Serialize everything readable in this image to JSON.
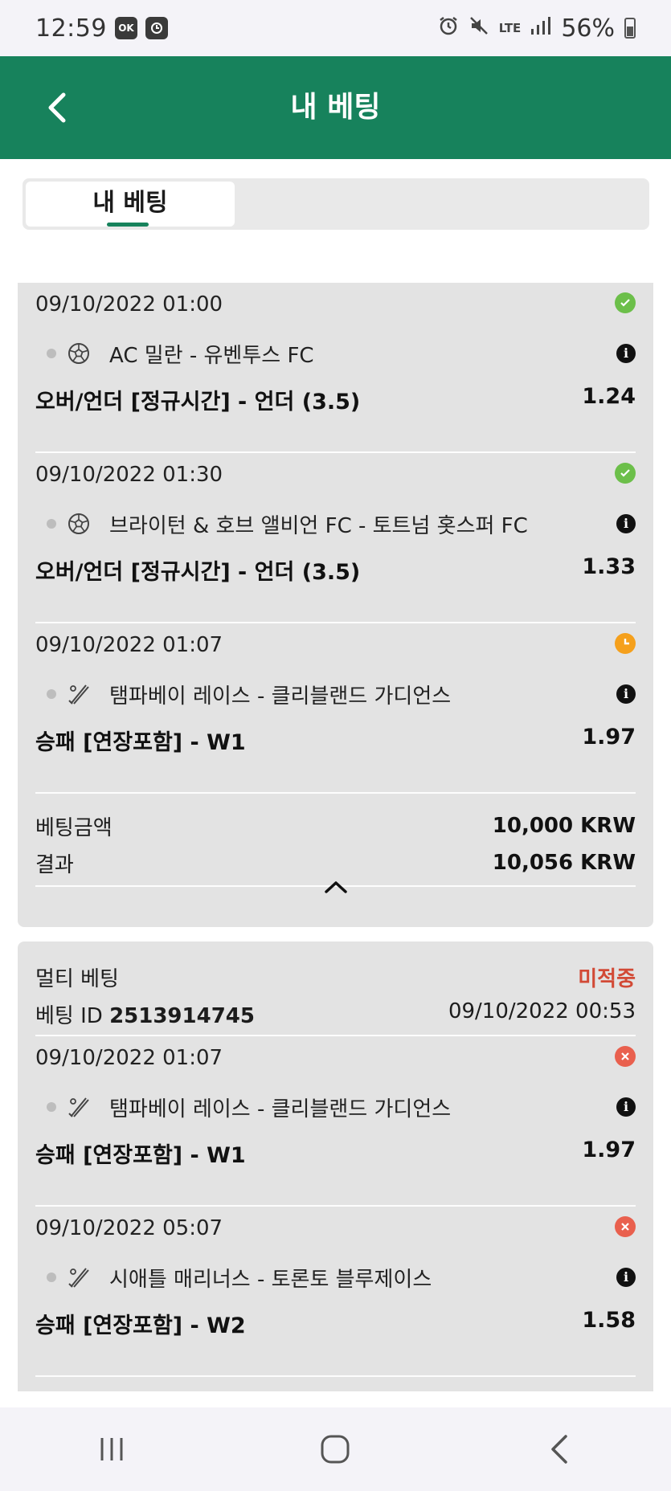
{
  "status_bar": {
    "time": "12:59",
    "app_icons": [
      "ok-app-icon",
      "clock-app-icon"
    ],
    "app_icon_text": "OK",
    "network": "LTE",
    "battery": "56%"
  },
  "header": {
    "title": "내 베팅"
  },
  "tabs": [
    {
      "label": "내 베팅",
      "active": true
    }
  ],
  "bet_slip_1": {
    "items": [
      {
        "datetime": "09/10/2022 01:00",
        "status": "won",
        "sport": "soccer",
        "match": "AC 밀란 - 유벤투스 FC",
        "market": "오버/언더 [정규시간] - 언더 (3.5)",
        "odds": "1.24"
      },
      {
        "datetime": "09/10/2022 01:30",
        "status": "won",
        "sport": "soccer",
        "match": "브라이턴 & 호브 앨비언 FC - 토트넘 홋스퍼 FC",
        "market": "오버/언더 [정규시간] - 언더 (3.5)",
        "odds": "1.33"
      },
      {
        "datetime": "09/10/2022 01:07",
        "status": "pending",
        "sport": "baseball",
        "match": "탬파베이 레이스 - 클리블랜드 가디언스",
        "market": "승패 [연장포함] - W1",
        "odds": "1.97"
      }
    ],
    "stake_label": "베팅금액",
    "stake_value": "10,000 KRW",
    "result_label": "결과",
    "result_value": "10,056 KRW"
  },
  "bet_slip_2": {
    "type": "멀티 베팅",
    "status": "미적중",
    "id_label": "베팅 ID",
    "id": "2513914745",
    "datetime": "09/10/2022 00:53",
    "items": [
      {
        "datetime": "09/10/2022 01:07",
        "status": "lost",
        "sport": "baseball",
        "match": "탬파베이 레이스 - 클리블랜드 가디언스",
        "market": "승패 [연장포함] - W1",
        "odds": "1.97"
      },
      {
        "datetime": "09/10/2022 05:07",
        "status": "lost",
        "sport": "baseball",
        "match": "시애틀 매리너스 - 토론토 블루제이스",
        "market": "승패 [연장포함] - W2",
        "odds": "1.58"
      }
    ]
  },
  "colors": {
    "brand": "#17825c",
    "won": "#6cbf4a",
    "pending": "#f5a01c",
    "lost": "#e9604e",
    "status_lost_text": "#d24a36"
  },
  "icons": {
    "info": "i"
  }
}
